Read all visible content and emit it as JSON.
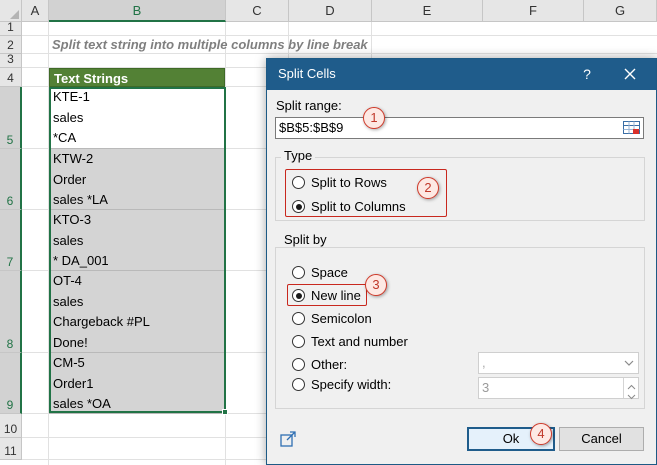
{
  "sheet": {
    "columns": [
      "A",
      "B",
      "C",
      "D",
      "E",
      "F",
      "G"
    ],
    "rows": [
      "1",
      "2",
      "3",
      "4",
      "5",
      "6",
      "7",
      "8",
      "9",
      "10",
      "11"
    ],
    "subtitle": "Split text string into multiple columns by line break",
    "header": "Text Strings",
    "cells": [
      {
        "lines": [
          "KTE-1",
          "sales",
          "*CA"
        ]
      },
      {
        "lines": [
          "KTW-2",
          "Order",
          "sales *LA"
        ]
      },
      {
        "lines": [
          "KTO-3",
          "sales",
          "* DA_001"
        ]
      },
      {
        "lines": [
          "OT-4",
          "sales",
          "Chargeback #PL",
          "Done!"
        ]
      },
      {
        "lines": [
          "CM-5",
          "Order1",
          "sales *OA"
        ]
      }
    ]
  },
  "dialog": {
    "title": "Split Cells",
    "help": "?",
    "split_range_label": "Split range:",
    "split_range_value": "$B$5:$B$9",
    "type_label": "Type",
    "type_options": [
      {
        "label": "Split to Rows",
        "selected": false
      },
      {
        "label": "Split to Columns",
        "selected": true
      }
    ],
    "split_by_label": "Split by",
    "split_by_options": [
      {
        "label": "Space",
        "selected": false
      },
      {
        "label": "New line",
        "selected": true
      },
      {
        "label": "Semicolon",
        "selected": false
      },
      {
        "label": "Text and number",
        "selected": false
      },
      {
        "label": "Other:",
        "selected": false
      },
      {
        "label": "Specify width:",
        "selected": false
      }
    ],
    "other_value": ",",
    "width_value": "3",
    "ok": "Ok",
    "cancel": "Cancel"
  },
  "callouts": [
    "1",
    "2",
    "3",
    "4"
  ],
  "colors": {
    "header_fill": "#538135",
    "selection": "#217346",
    "titlebar": "#1f5c8b",
    "callout": "#c8281e"
  }
}
